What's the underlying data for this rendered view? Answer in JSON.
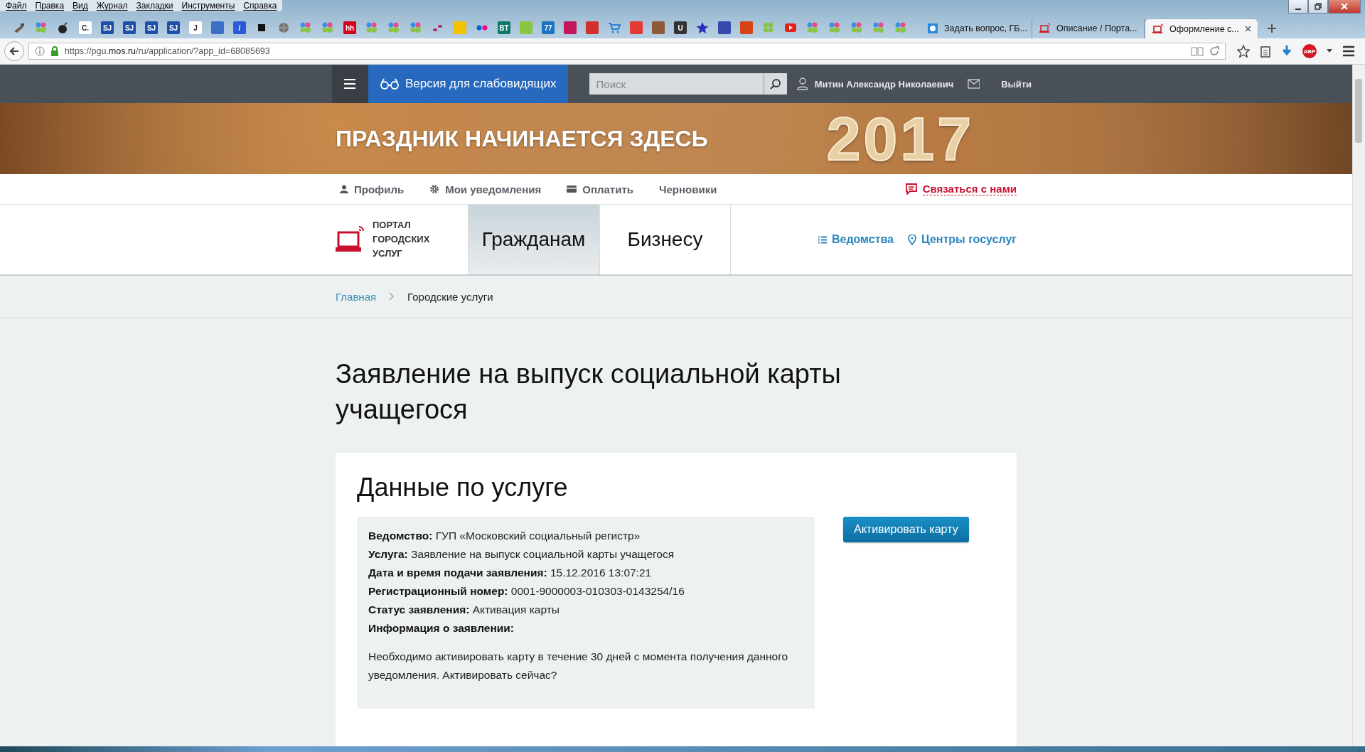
{
  "browser": {
    "menu": [
      "Файл",
      "Правка",
      "Вид",
      "Журнал",
      "Закладки",
      "Инструменты",
      "Справка"
    ],
    "bookmarks": [
      {
        "kind": "tool"
      },
      {
        "kind": "dots"
      },
      {
        "kind": "bomb"
      },
      {
        "kind": "letter",
        "glyph": "C.",
        "color": "#ffffff"
      },
      {
        "kind": "letter",
        "glyph": "SJ",
        "color": "#1f4fa8"
      },
      {
        "kind": "letter",
        "glyph": "SJ",
        "color": "#1f4fa8"
      },
      {
        "kind": "letter",
        "glyph": "SJ",
        "color": "#1f4fa8"
      },
      {
        "kind": "letter",
        "glyph": "SJ",
        "color": "#1f4fa8"
      },
      {
        "kind": "letter",
        "glyph": "J",
        "color": "#ffffff"
      },
      {
        "kind": "tile",
        "color": "#3a6fc4"
      },
      {
        "kind": "letter",
        "glyph": "/",
        "color": "#2a5bd7"
      },
      {
        "kind": "square"
      },
      {
        "kind": "globe"
      },
      {
        "kind": "dots"
      },
      {
        "kind": "dots"
      },
      {
        "kind": "letter",
        "glyph": "hh",
        "color": "#d6001c"
      },
      {
        "kind": "dots"
      },
      {
        "kind": "dots"
      },
      {
        "kind": "dots"
      },
      {
        "kind": "paws"
      },
      {
        "kind": "tile",
        "color": "#f2c200"
      },
      {
        "kind": "flickr"
      },
      {
        "kind": "letter",
        "glyph": "BT",
        "color": "#0b7a6a"
      },
      {
        "kind": "tile",
        "color": "#8cc63f"
      },
      {
        "kind": "letter",
        "glyph": "77",
        "color": "#1e73be"
      },
      {
        "kind": "tile",
        "color": "#c2185b"
      },
      {
        "kind": "tile",
        "color": "#d32f2f"
      },
      {
        "kind": "cart"
      },
      {
        "kind": "tile",
        "color": "#e53935"
      },
      {
        "kind": "tile",
        "color": "#8d5a3b"
      },
      {
        "kind": "letter",
        "glyph": "U",
        "color": "#333333"
      },
      {
        "kind": "star"
      },
      {
        "kind": "tile",
        "color": "#3949ab"
      },
      {
        "kind": "tile",
        "color": "#d84315"
      },
      {
        "kind": "greendots"
      },
      {
        "kind": "play"
      },
      {
        "kind": "dots"
      },
      {
        "kind": "dots"
      },
      {
        "kind": "dots"
      },
      {
        "kind": "dots"
      },
      {
        "kind": "dots"
      }
    ],
    "tabs": [
      {
        "title": "Задать вопрос, ГБ...",
        "selected": false,
        "kind": "help"
      },
      {
        "title": "Описание / Порта...",
        "selected": false,
        "kind": "portal"
      },
      {
        "title": "Оформление с...",
        "selected": true,
        "kind": "portal"
      }
    ],
    "url": "https://pgu.**mos.ru**/ru/application/?app_id=68085693",
    "addon_badge": "ABP"
  },
  "site": {
    "accessibility_button": "Версия для слабовидящих",
    "search": {
      "placeholder": "Поиск"
    },
    "user_name": "Митин Александр Николаевич",
    "logout": "Выйти"
  },
  "banner": {
    "headline": "ПРАЗДНИК НАЧИНАЕТСЯ ЗДЕСЬ",
    "year": "2017"
  },
  "subnav": {
    "items": [
      {
        "label": "Профиль",
        "kind": "person"
      },
      {
        "label": "Мои уведомления",
        "kind": "gear"
      },
      {
        "label": "Оплатить",
        "kind": "card"
      },
      {
        "label": "Черновики",
        "kind": "none"
      }
    ],
    "contact": "Связаться с нами"
  },
  "header": {
    "logo_text": "ПОРТАЛ ГОРОДСКИХ УСЛУГ",
    "tabs": [
      {
        "label": "Гражданам",
        "selected": true
      },
      {
        "label": "Бизнесу",
        "selected": false
      }
    ],
    "links": [
      {
        "label": "Ведомства",
        "kind": "list"
      },
      {
        "label": "Центры госуслуг",
        "kind": "pin"
      }
    ]
  },
  "breadcrumbs": [
    "Главная",
    "Городские услуги"
  ],
  "page_title": "Заявление на выпуск социальной карты учащегося",
  "card": {
    "title": "Данные по услуге",
    "fields": [
      {
        "label": "Ведомство:",
        "value": "ГУП «Московский социальный регистр»"
      },
      {
        "label": "Услуга:",
        "value": "Заявление на выпуск социальной карты учащегося"
      },
      {
        "label": "Дата и время подачи заявления:",
        "value": "15.12.2016 13:07:21"
      },
      {
        "label": "Регистрационный номер:",
        "value": "0001-9000003-010303-0143254/16"
      },
      {
        "label": "Статус заявления:",
        "value": "Активация карты"
      },
      {
        "label": "Информация о заявлении:"
      }
    ],
    "note": "Необходимо активировать карту в течение 30 дней с момента получения данного уведомления. Активировать сейчас?",
    "button": "Активировать карту"
  }
}
